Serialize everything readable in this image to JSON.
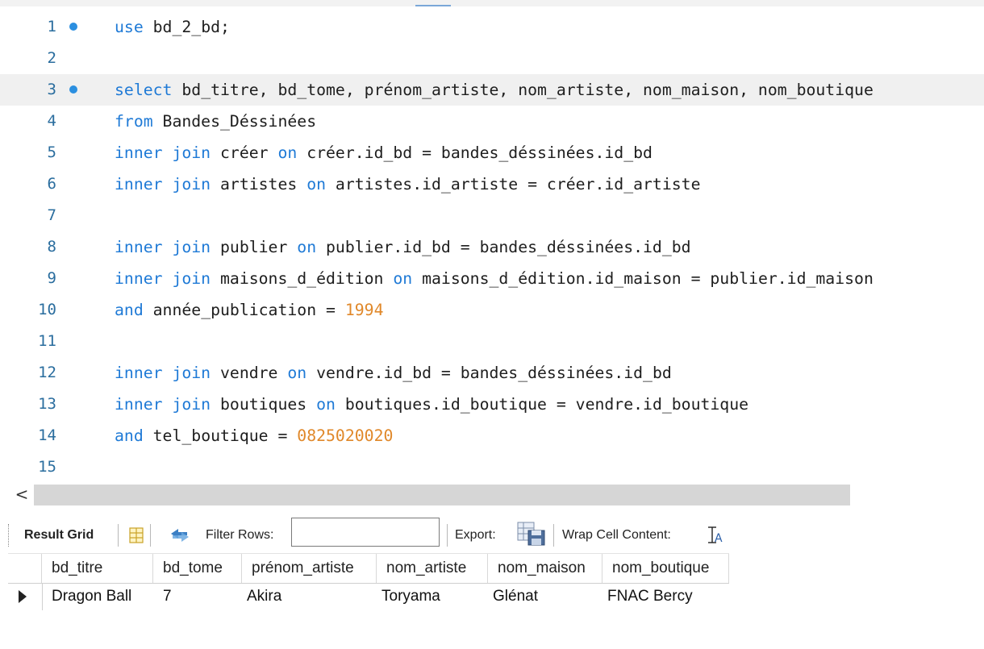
{
  "editor": {
    "lines": [
      {
        "num": "1",
        "marker": true,
        "tokens": [
          [
            "kw",
            "use"
          ],
          [
            "t",
            " bd_2_bd;"
          ]
        ]
      },
      {
        "num": "2",
        "marker": false,
        "tokens": []
      },
      {
        "num": "3",
        "marker": true,
        "current": true,
        "tokens": [
          [
            "kw",
            "select"
          ],
          [
            "t",
            " bd_titre, bd_tome, prénom_artiste, nom_artiste, nom_maison, nom_boutique"
          ]
        ]
      },
      {
        "num": "4",
        "marker": false,
        "tokens": [
          [
            "kw",
            "from"
          ],
          [
            "t",
            " Bandes_Déssinées"
          ]
        ]
      },
      {
        "num": "5",
        "marker": false,
        "tokens": [
          [
            "kw",
            "inner join"
          ],
          [
            "t",
            " créer "
          ],
          [
            "kw",
            "on"
          ],
          [
            "t",
            " créer.id_bd = bandes_déssinées.id_bd"
          ]
        ]
      },
      {
        "num": "6",
        "marker": false,
        "tokens": [
          [
            "kw",
            "inner join"
          ],
          [
            "t",
            " artistes "
          ],
          [
            "kw",
            "on"
          ],
          [
            "t",
            " artistes.id_artiste = créer.id_artiste"
          ]
        ]
      },
      {
        "num": "7",
        "marker": false,
        "tokens": []
      },
      {
        "num": "8",
        "marker": false,
        "tokens": [
          [
            "kw",
            "inner join"
          ],
          [
            "t",
            " publier "
          ],
          [
            "kw",
            "on"
          ],
          [
            "t",
            " publier.id_bd = bandes_déssinées.id_bd"
          ]
        ]
      },
      {
        "num": "9",
        "marker": false,
        "tokens": [
          [
            "kw",
            "inner join"
          ],
          [
            "t",
            " maisons_d_édition "
          ],
          [
            "kw",
            "on"
          ],
          [
            "t",
            " maisons_d_édition.id_maison = publier.id_maison"
          ]
        ]
      },
      {
        "num": "10",
        "marker": false,
        "tokens": [
          [
            "kw",
            "and"
          ],
          [
            "t",
            " année_publication = "
          ],
          [
            "num",
            "1994"
          ]
        ]
      },
      {
        "num": "11",
        "marker": false,
        "tokens": []
      },
      {
        "num": "12",
        "marker": false,
        "tokens": [
          [
            "kw",
            "inner join"
          ],
          [
            "t",
            " vendre "
          ],
          [
            "kw",
            "on"
          ],
          [
            "t",
            " vendre.id_bd = bandes_déssinées.id_bd"
          ]
        ]
      },
      {
        "num": "13",
        "marker": false,
        "tokens": [
          [
            "kw",
            "inner join"
          ],
          [
            "t",
            " boutiques "
          ],
          [
            "kw",
            "on"
          ],
          [
            "t",
            " boutiques.id_boutique = vendre.id_boutique"
          ]
        ]
      },
      {
        "num": "14",
        "marker": false,
        "tokens": [
          [
            "kw",
            "and"
          ],
          [
            "t",
            " tel_boutique = "
          ],
          [
            "num",
            "0825020020"
          ]
        ]
      },
      {
        "num": "15",
        "marker": false,
        "tokens": []
      }
    ]
  },
  "scrollbar": {
    "left_arrow": "<"
  },
  "toolbar": {
    "result_grid": "Result Grid",
    "filter_rows": "Filter Rows:",
    "filter_value": "",
    "export": "Export:",
    "wrap_cell": "Wrap Cell Content:",
    "icons": {
      "grid": "grid-icon",
      "refresh": "refresh-icon",
      "export": "export-icon",
      "wrap": "wrap-text-icon"
    }
  },
  "result": {
    "columns": [
      "bd_titre",
      "bd_tome",
      "prénom_artiste",
      "nom_artiste",
      "nom_maison",
      "nom_boutique"
    ],
    "rows": [
      [
        "Dragon Ball",
        "7",
        "Akira",
        "Toryama",
        "Glénat",
        "FNAC Bercy"
      ]
    ]
  },
  "colors": {
    "keyword": "#1f7ad6",
    "number": "#e0882a",
    "line_number": "#2a6d9e",
    "marker": "#2b8fe0"
  }
}
